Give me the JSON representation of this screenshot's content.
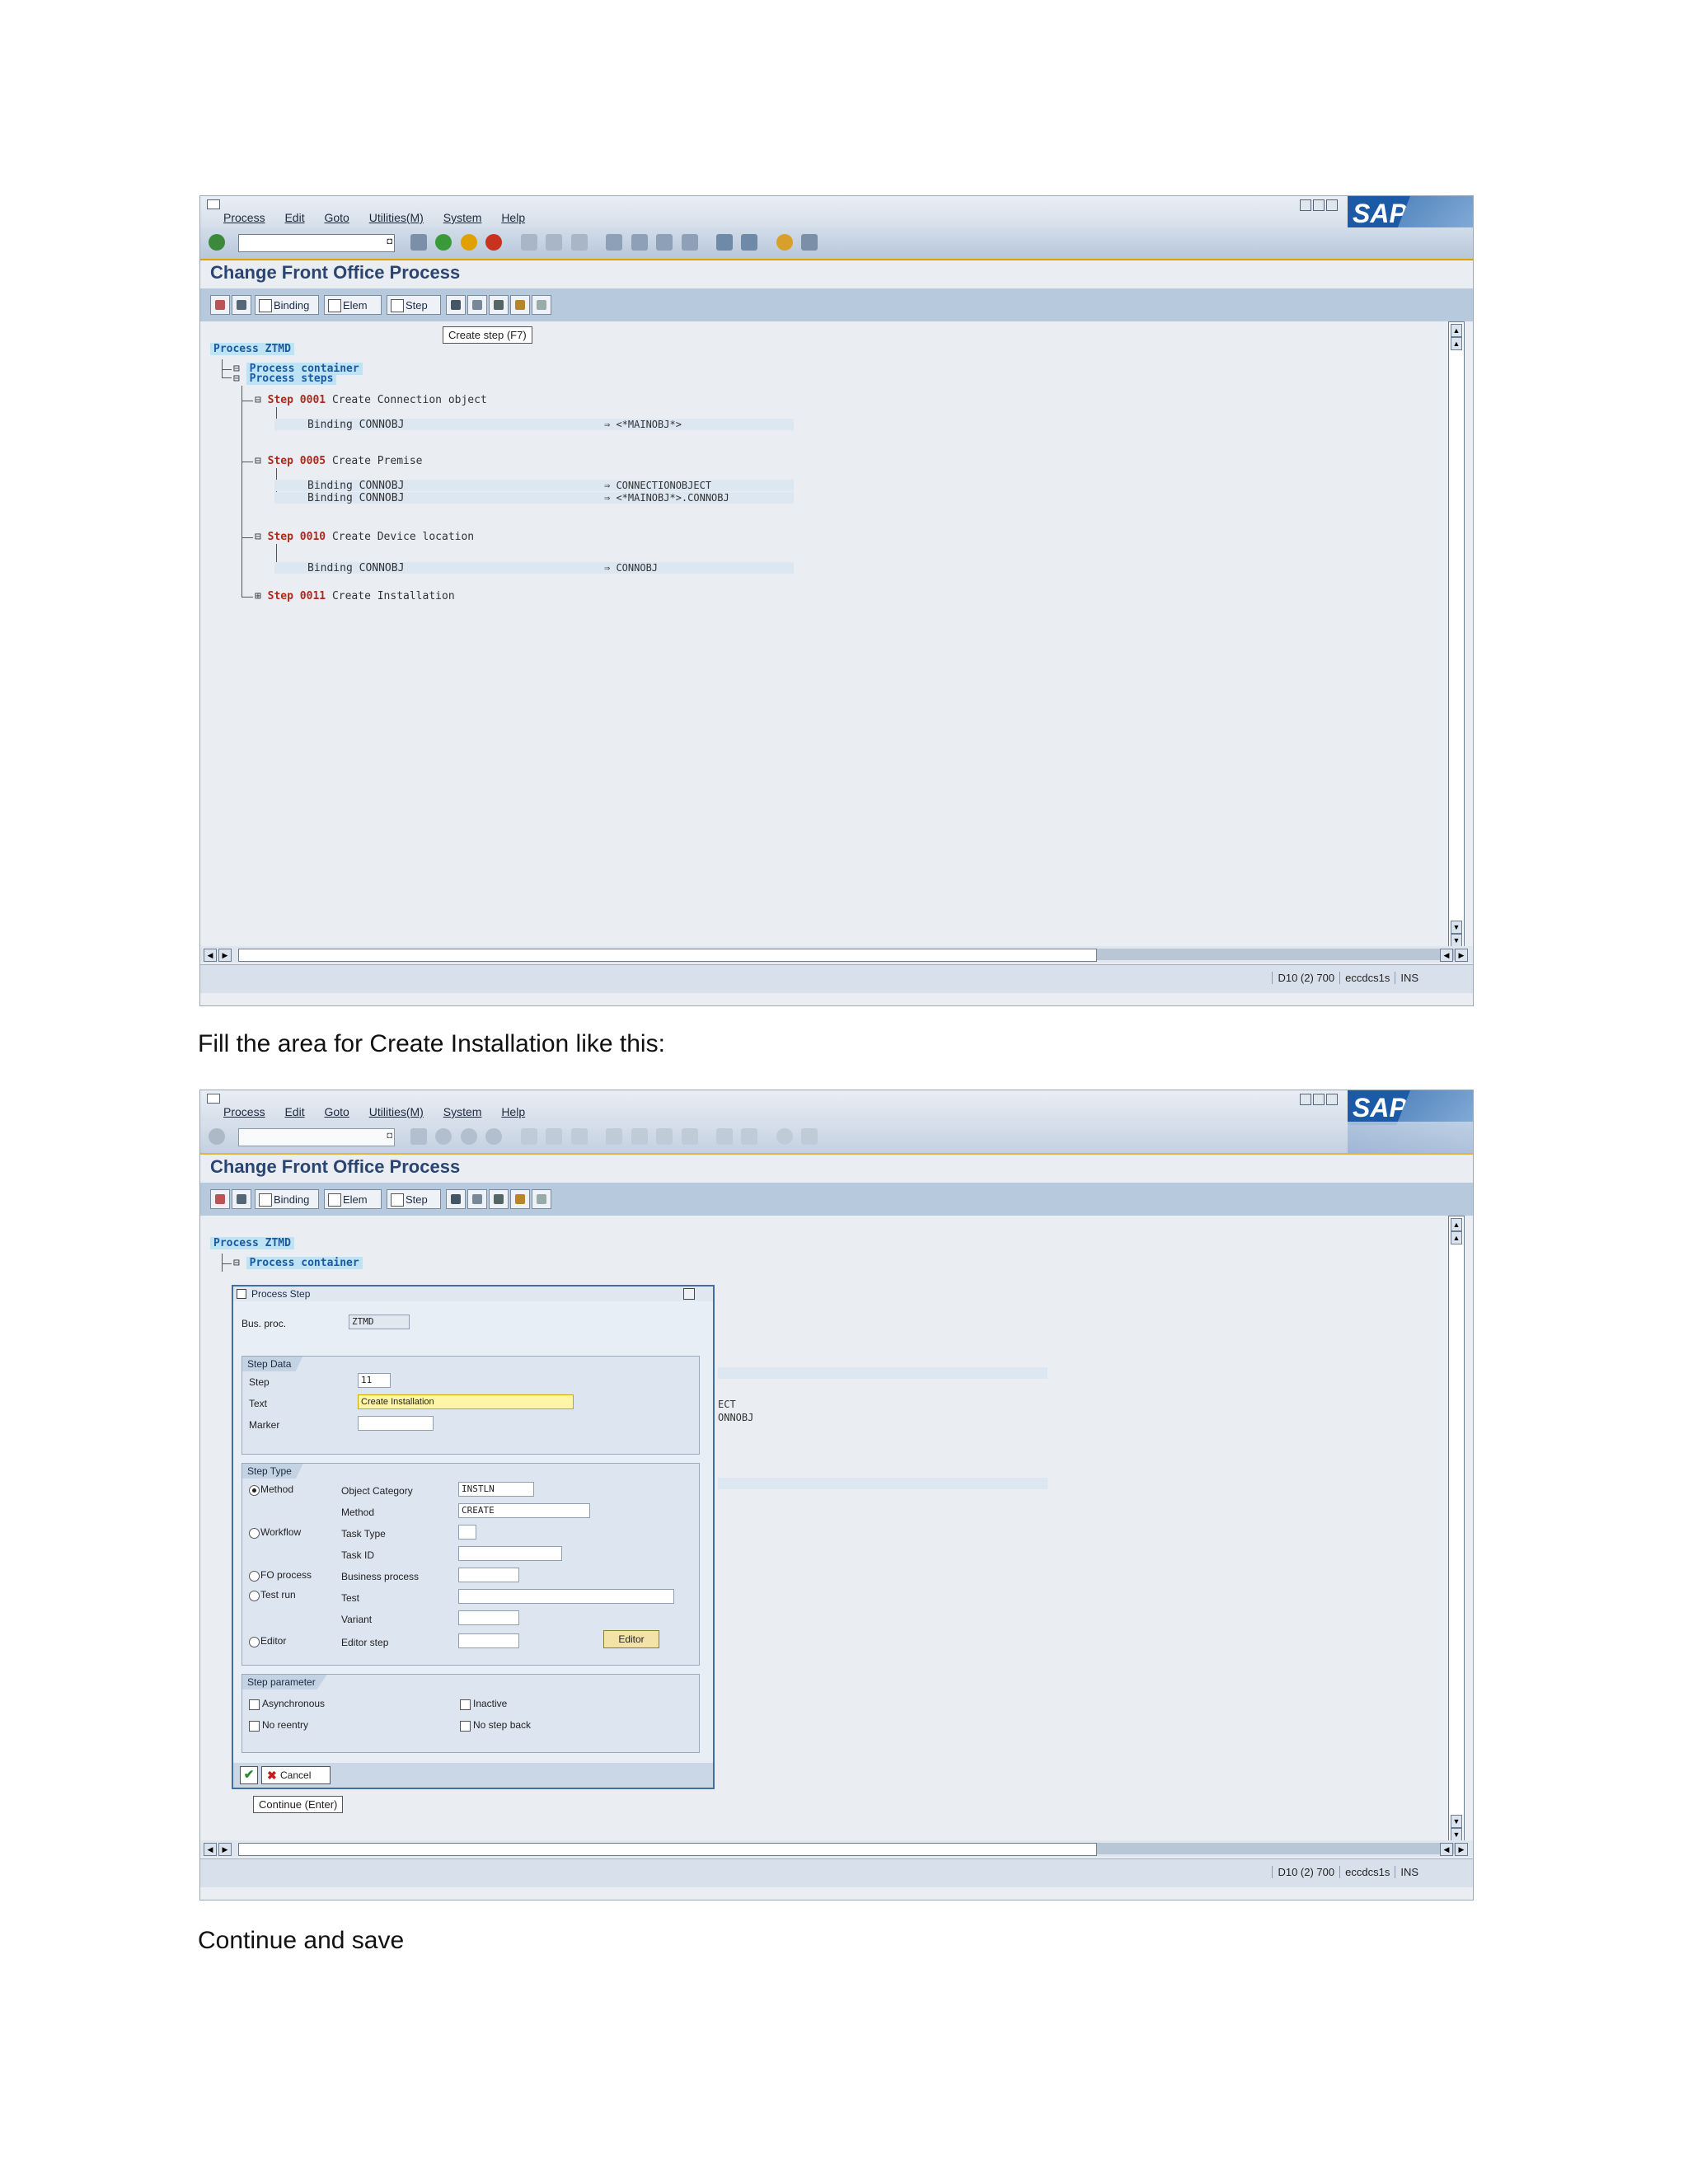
{
  "screen1": {
    "menu": [
      "Process",
      "Edit",
      "Goto",
      "Utilities(M)",
      "System",
      "Help"
    ],
    "window_title": "Change Front Office Process",
    "app_toolbar": {
      "binding": "Binding",
      "elem": "Elem",
      "step": "Step"
    },
    "tooltip": "Create step  (F7)",
    "tree": {
      "root": "Process ZTMD",
      "container": "Process container",
      "steps_label": "Process steps",
      "step1": {
        "kw": "Step 0001",
        "text": "Create Connection object",
        "binding": "Binding CONNOBJ",
        "target": "<*MAINOBJ*>"
      },
      "step5": {
        "kw": "Step 0005",
        "text": "Create Premise",
        "binding1": "Binding CONNOBJ",
        "target1": "CONNECTIONOBJECT",
        "binding2": "Binding CONNOBJ",
        "target2": "<*MAINOBJ*>.CONNOBJ"
      },
      "step10": {
        "kw": "Step 0010",
        "text": "Create Device location",
        "binding": "Binding CONNOBJ",
        "target": "CONNOBJ"
      },
      "step11": {
        "kw": "Step 0011",
        "text": "Create Installation"
      }
    },
    "status": {
      "system": "D10 (2) 700",
      "server": "eccdcs1s",
      "mode": "INS"
    }
  },
  "caption1": "Fill the area for Create Installation like this:",
  "screen2": {
    "menu": [
      "Process",
      "Edit",
      "Goto",
      "Utilities(M)",
      "System",
      "Help"
    ],
    "window_title": "Change Front Office Process",
    "app_toolbar": {
      "binding": "Binding",
      "elem": "Elem",
      "step": "Step"
    },
    "tree": {
      "root": "Process ZTMD",
      "container": "Process container",
      "bg_frag1": "ECT",
      "bg_frag2": "ONNOBJ"
    },
    "dialog": {
      "title": "Process Step",
      "bus_proc_label": "Bus. proc.",
      "bus_proc_value": "ZTMD",
      "step_data": {
        "title": "Step Data",
        "step_label": "Step",
        "step_value": "11",
        "text_label": "Text",
        "text_value": "Create Installation",
        "marker_label": "Marker"
      },
      "step_type": {
        "title": "Step Type",
        "method_radio": "Method",
        "object_category_label": "Object Category",
        "object_category_value": "INSTLN",
        "method_label": "Method",
        "method_value": "CREATE",
        "workflow_radio": "Workflow",
        "task_type_label": "Task Type",
        "task_id_label": "Task ID",
        "fo_process_radio": "FO process",
        "business_process_label": "Business process",
        "test_run_radio": "Test run",
        "test_label": "Test",
        "variant_label": "Variant",
        "editor_radio": "Editor",
        "editor_step_label": "Editor step",
        "editor_button": "Editor"
      },
      "step_parameter": {
        "title": "Step parameter",
        "asynchronous": "Asynchronous",
        "no_reentry": "No reentry",
        "inactive": "Inactive",
        "no_step_back": "No step back"
      },
      "cancel_button": "Cancel"
    },
    "tooltip": "Continue  (Enter)",
    "status": {
      "system": "D10 (2) 700",
      "server": "eccdcs1s",
      "mode": "INS"
    }
  },
  "caption2": "Continue and save",
  "colors": {
    "sap_blue": "#1a5aa6",
    "title_blue": "#2b4570",
    "highlight": "#fff5a8",
    "keyword_red": "#b1271b"
  },
  "icons": [
    "enter-icon",
    "save-icon",
    "back-icon",
    "exit-icon",
    "cancel-icon",
    "print-icon",
    "find-icon",
    "sap-logo"
  ]
}
